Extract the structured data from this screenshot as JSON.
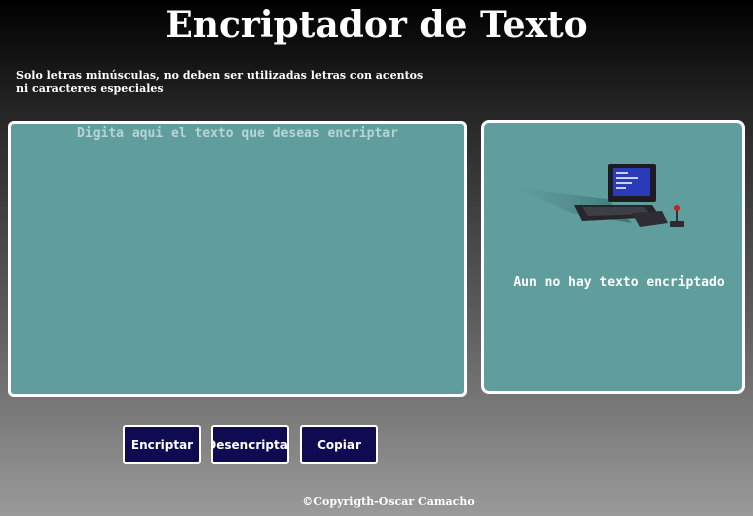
{
  "header": {
    "title": "Encriptador de Texto",
    "hint_line1": "Solo letras minúsculas, no deben ser utilizadas letras con acentos",
    "hint_line2": "ni caracteres especiales"
  },
  "input": {
    "value": "",
    "placeholder": "Digita aqui el texto que deseas encriptar"
  },
  "output": {
    "image_icon": "retro-computer-illustration",
    "empty_message": "Aun no hay texto encriptado"
  },
  "buttons": {
    "encrypt_label": "Encriptar",
    "decrypt_label": "Desencriptar",
    "copy_label": "Copiar"
  },
  "footer": {
    "copyright": "©Copyrigth-Oscar Camacho"
  },
  "colors": {
    "panel": "#609e9e",
    "button": "#100a52",
    "border": "#ffffff"
  }
}
